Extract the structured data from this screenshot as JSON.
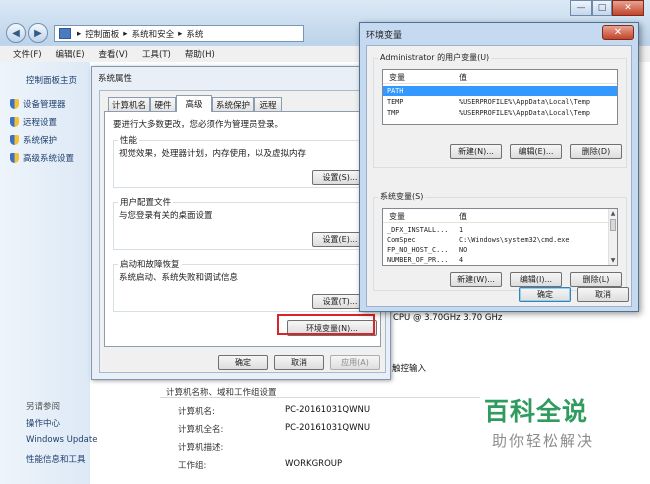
{
  "window": {
    "breadcrumb": [
      "控制面板",
      "系统和安全",
      "系统"
    ],
    "menubar": [
      "文件(F)",
      "编辑(E)",
      "查看(V)",
      "工具(T)",
      "帮助(H)"
    ],
    "controls": [
      "—",
      "□",
      "✕"
    ]
  },
  "sidebar": {
    "home": "控制面板主页",
    "items": [
      "设备管理器",
      "远程设置",
      "系统保护",
      "高级系统设置"
    ],
    "also_see": "另请参阅",
    "bottom_links": [
      "操作中心",
      "Windows Update",
      "性能信息和工具"
    ]
  },
  "system_info": {
    "cpu": "CPU @ 3.70GHz   3.70 GHz",
    "touch": "触控输入",
    "section_title": "计算机名称、域和工作组设置",
    "rows": [
      {
        "label": "计算机名:",
        "value": "PC-20161031QWNU"
      },
      {
        "label": "计算机全名:",
        "value": "PC-20161031QWNU"
      },
      {
        "label": "计算机描述:",
        "value": ""
      },
      {
        "label": "工作组:",
        "value": "WORKGROUP"
      }
    ]
  },
  "system_properties": {
    "title": "系统属性",
    "tabs": [
      "计算机名",
      "硬件",
      "高级",
      "系统保护",
      "远程"
    ],
    "active_tab": "高级",
    "admin_note": "要进行大多数更改，您必须作为管理员登录。",
    "groups": [
      {
        "title": "性能",
        "desc": "视觉效果，处理器计划，内存使用，以及虚拟内存",
        "button": "设置(S)..."
      },
      {
        "title": "用户配置文件",
        "desc": "与您登录有关的桌面设置",
        "button": "设置(E)..."
      },
      {
        "title": "启动和故障恢复",
        "desc": "系统启动、系统失败和调试信息",
        "button": "设置(T)..."
      }
    ],
    "env_button": "环境变量(N)...",
    "ok": "确定",
    "cancel": "取消",
    "apply": "应用(A)"
  },
  "env_vars": {
    "title": "环境变量",
    "close": "✕",
    "user_group_title": "Administrator 的用户变量(U)",
    "col_var": "变量",
    "col_val": "值",
    "user_vars": [
      {
        "name": "PATH",
        "value": ""
      },
      {
        "name": "TEMP",
        "value": "%USERPROFILE%\\AppData\\Local\\Temp"
      },
      {
        "name": "TMP",
        "value": "%USERPROFILE%\\AppData\\Local\\Temp"
      }
    ],
    "user_buttons": [
      "新建(N)...",
      "编辑(E)...",
      "删除(D)"
    ],
    "sys_group_title": "系统变量(S)",
    "sys_vars": [
      {
        "name": "_DFX_INSTALL...",
        "value": "1"
      },
      {
        "name": "ComSpec",
        "value": "C:\\Windows\\system32\\cmd.exe"
      },
      {
        "name": "FP_NO_HOST_C...",
        "value": "NO"
      },
      {
        "name": "NUMBER_OF_PR...",
        "value": "4"
      }
    ],
    "sys_buttons": [
      "新建(W)...",
      "编辑(I)...",
      "删除(L)"
    ],
    "ok": "确定",
    "cancel": "取消"
  },
  "watermark": {
    "title": "百科全说",
    "subtitle": "助你轻松解决"
  }
}
